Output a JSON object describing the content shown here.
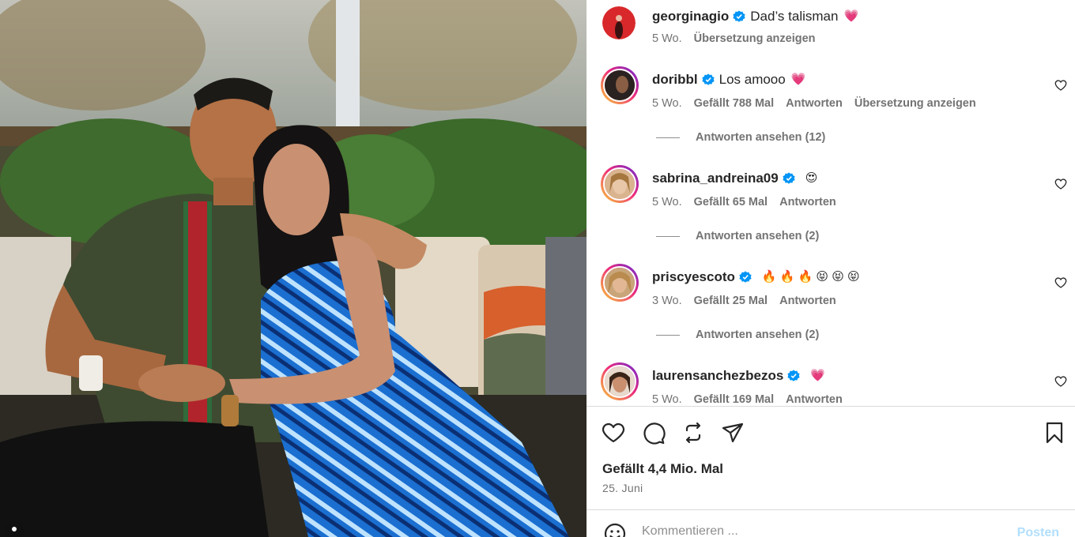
{
  "post": {
    "caption": {
      "username": "georginagio",
      "verified": true,
      "text": "Dad’s talisman",
      "emoji": "💗",
      "time": "5 Wo.",
      "translate": "Übersetzung anzeigen"
    },
    "likes_text": "Gefällt 4,4 Mio. Mal",
    "date": "25. Juni"
  },
  "comments": [
    {
      "username": "doribbl",
      "text": "Los amooo",
      "emoji": "💗",
      "time": "5 Wo.",
      "likes": "Gefällt 788 Mal",
      "reply": "Antworten",
      "translate": "Übersetzung anzeigen",
      "view_replies": "Antworten ansehen (12)"
    },
    {
      "username": "sabrina_andreina09",
      "text": "",
      "emoji": "😍",
      "time": "5 Wo.",
      "likes": "Gefällt 65 Mal",
      "reply": "Antworten",
      "view_replies": "Antworten ansehen (2)"
    },
    {
      "username": "priscyescoto",
      "text": "",
      "emoji": "🔥 🔥 🔥 😝 😝 😝",
      "time": "3 Wo.",
      "likes": "Gefällt 25 Mal",
      "reply": "Antworten",
      "view_replies": "Antworten ansehen (2)"
    },
    {
      "username": "laurensanchezbezos",
      "text": "",
      "emoji": "💗",
      "time": "5 Wo.",
      "likes": "Gefällt 169 Mal",
      "reply": "Antworten"
    }
  ],
  "composer": {
    "placeholder": "Kommentieren ...",
    "post_label": "Posten"
  },
  "icons": {
    "verified": "verified-badge-icon",
    "like": "heart-icon",
    "comment": "comment-bubble-icon",
    "repost": "repost-icon",
    "share": "paper-plane-icon",
    "save": "bookmark-icon",
    "emoji": "smiley-icon"
  },
  "colors": {
    "verified_blue": "#0095f6",
    "post_disabled": "#b2dffc",
    "story_ring_start": "#f9ce34",
    "story_ring_end": "#6228d7"
  }
}
